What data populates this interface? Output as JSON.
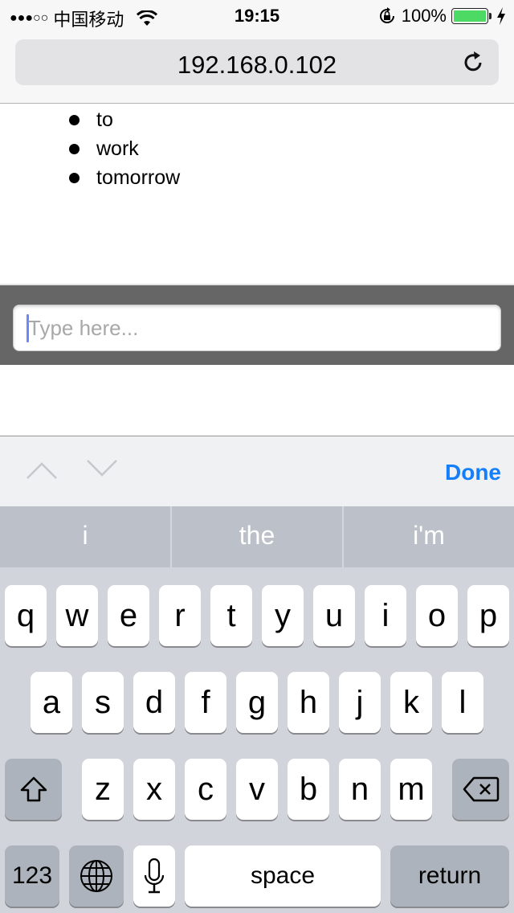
{
  "status_bar": {
    "signal": "●●●○○",
    "carrier": "中国移动",
    "time": "19:15",
    "battery_percent": "100%",
    "battery_level": 1.0,
    "battery_color": "#4cd964",
    "icons": [
      "wifi-icon",
      "rotation-lock-icon",
      "battery-icon",
      "charging-bolt-icon"
    ]
  },
  "browser": {
    "url": "192.168.0.102",
    "reload_icon": "reload-icon"
  },
  "page": {
    "list_items": [
      "to",
      "work",
      "tomorrow"
    ],
    "input_placeholder": "Type here...",
    "input_value": ""
  },
  "keyboard_accessory": {
    "prev_icon": "chevron-up-icon",
    "next_icon": "chevron-down-icon",
    "done_label": "Done",
    "done_color": "#147efb"
  },
  "suggestions": [
    "i",
    "the",
    "i'm"
  ],
  "keyboard": {
    "row1": [
      "q",
      "w",
      "e",
      "r",
      "t",
      "y",
      "u",
      "i",
      "o",
      "p"
    ],
    "row2": [
      "a",
      "s",
      "d",
      "f",
      "g",
      "h",
      "j",
      "k",
      "l"
    ],
    "row3": [
      "z",
      "x",
      "c",
      "v",
      "b",
      "n",
      "m"
    ],
    "numbers_label": "123",
    "space_label": "space",
    "return_label": "return"
  }
}
